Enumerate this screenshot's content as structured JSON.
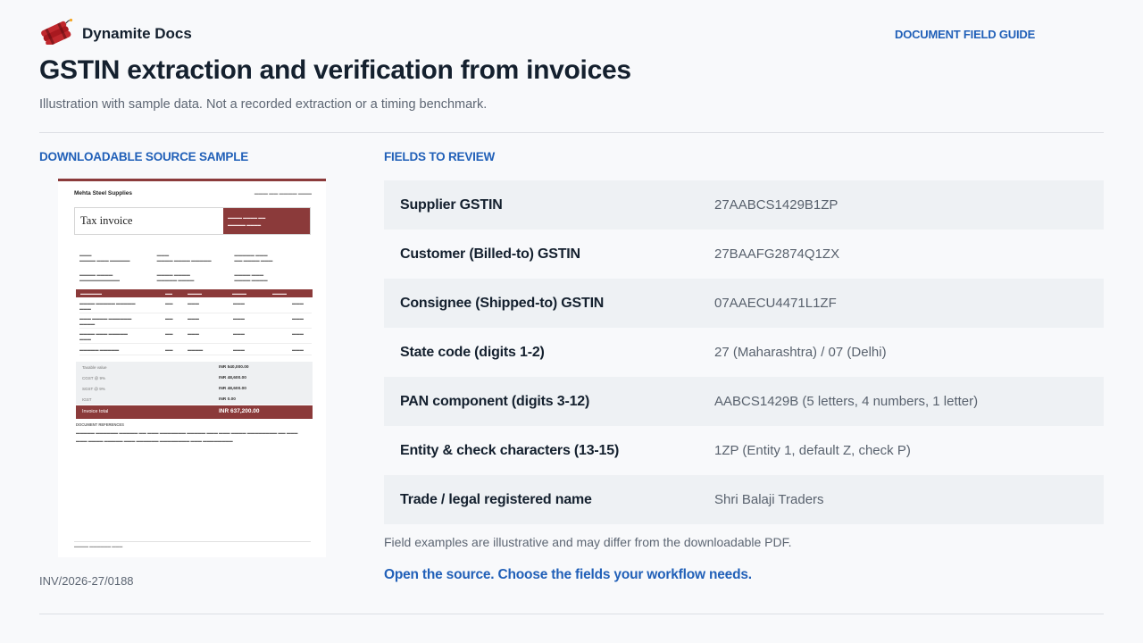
{
  "brand": {
    "name": "Dynamite Docs",
    "logo_icon": "dynamite-sticks-icon"
  },
  "header": {
    "guide_link": "DOCUMENT FIELD GUIDE"
  },
  "page": {
    "title": "GSTIN extraction and verification from invoices",
    "subtitle": "Illustration with sample data. Not a recorded extraction or a timing benchmark."
  },
  "source_sample": {
    "label": "DOWNLOADABLE SOURCE SAMPLE",
    "invoice_number": "INV/2026-27/0188",
    "thumbnail": {
      "supplier": "Mehta Steel Supplies",
      "doc_title": "Tax invoice",
      "grand_total_label": "Invoice total",
      "grand_total": "INR 637,200.00",
      "totals": [
        {
          "label": "Taxable value",
          "amount": "INR 540,000.00"
        },
        {
          "label": "CGST @ 9%",
          "amount": "INR 48,600.00"
        },
        {
          "label": "SGST @ 9%",
          "amount": "INR 48,600.00"
        },
        {
          "label": "IGST",
          "amount": "INR 0.00"
        }
      ],
      "notes_heading": "DOCUMENT REFERENCES"
    }
  },
  "fields_section": {
    "label": "FIELDS TO REVIEW",
    "rows": [
      {
        "name": "Supplier GSTIN",
        "value": "27AABCS1429B1ZP"
      },
      {
        "name": "Customer (Billed-to) GSTIN",
        "value": "27BAAFG2874Q1ZX"
      },
      {
        "name": "Consignee (Shipped-to) GSTIN",
        "value": "07AAECU4471L1ZF"
      },
      {
        "name": "State code (digits 1-2)",
        "value": "27 (Maharashtra) / 07 (Delhi)"
      },
      {
        "name": "PAN component (digits 3-12)",
        "value": "AABCS1429B (5 letters, 4 numbers, 1 letter)"
      },
      {
        "name": "Entity & check characters (13-15)",
        "value": "1ZP (Entity 1, default Z, check P)"
      },
      {
        "name": "Trade / legal registered name",
        "value": "Shri Balaji Traders"
      }
    ],
    "disclaimer": "Field examples are illustrative and may differ from the downloadable PDF.",
    "cta": "Open the source. Choose the fields your workflow needs."
  },
  "colors": {
    "accent": "#2160b8",
    "invoice_brand": "#8b3a3a",
    "row_alt": "#eef1f4"
  }
}
